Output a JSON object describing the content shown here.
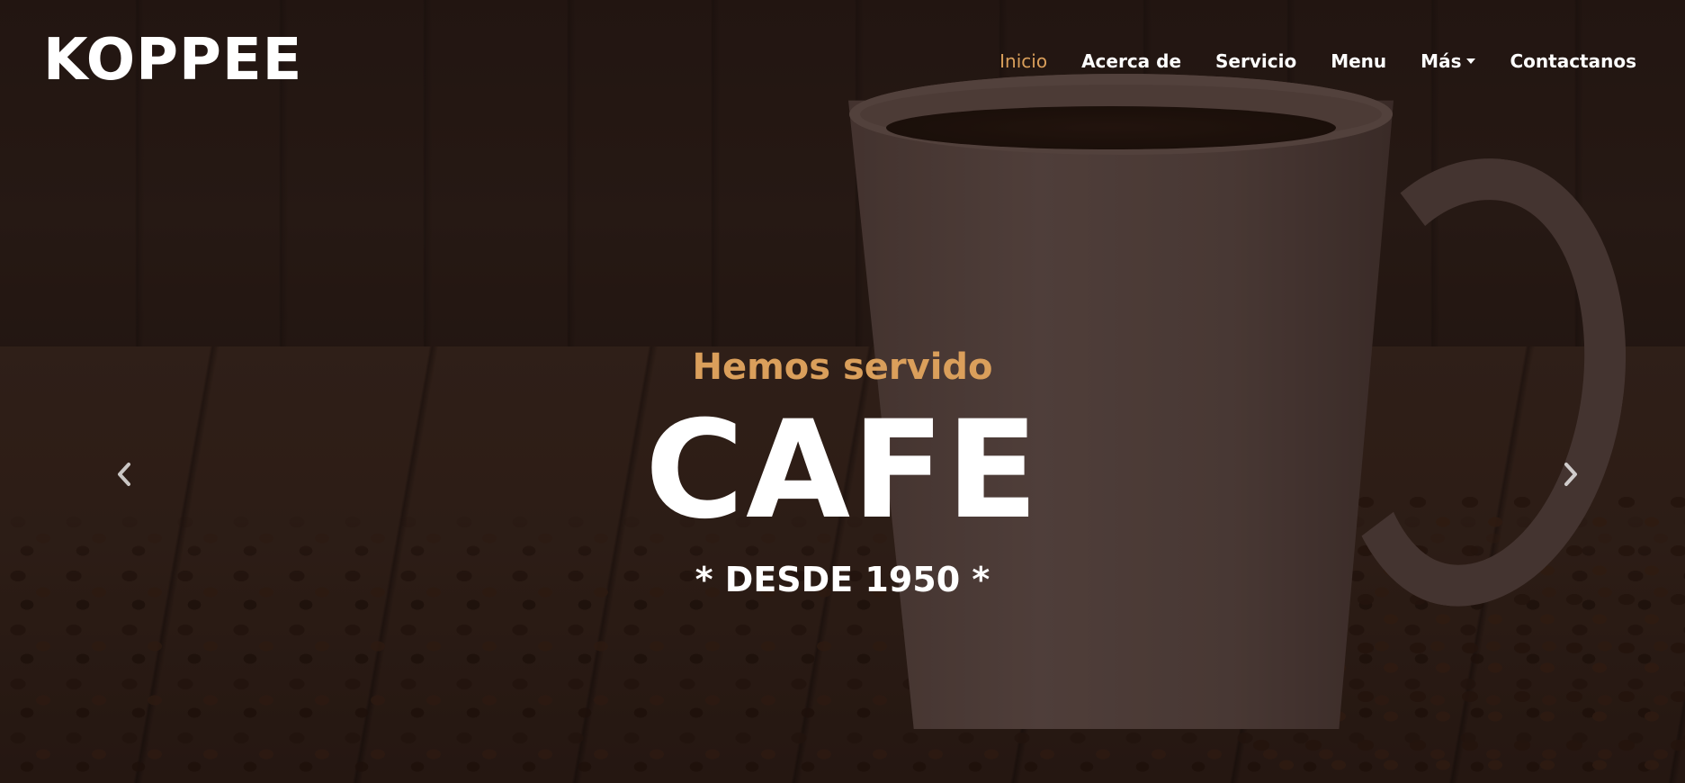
{
  "brand": "KOPPEE",
  "nav": {
    "items": [
      {
        "label": "Inicio",
        "active": true
      },
      {
        "label": "Acerca de"
      },
      {
        "label": "Servicio"
      },
      {
        "label": "Menu"
      },
      {
        "label": "Más",
        "dropdown": true
      },
      {
        "label": "Contactanos"
      }
    ]
  },
  "hero": {
    "subtitle": "Hemos servido",
    "headline": "CAFE",
    "tagline": "* DESDE 1950 *"
  },
  "icons": {
    "prev": "chevron-left-icon",
    "next": "chevron-right-icon",
    "dropdown": "caret-down-icon"
  },
  "colors": {
    "accent": "#da9f5b",
    "text": "#ffffff"
  }
}
